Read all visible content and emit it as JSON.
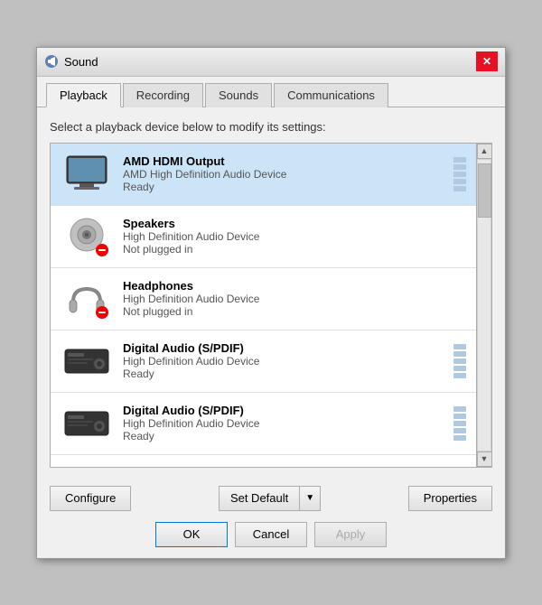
{
  "dialog": {
    "title": "Sound",
    "icon": "speaker-icon"
  },
  "tabs": [
    {
      "label": "Playback",
      "active": true
    },
    {
      "label": "Recording",
      "active": false
    },
    {
      "label": "Sounds",
      "active": false
    },
    {
      "label": "Communications",
      "active": false
    }
  ],
  "description": "Select a playback device below to modify its settings:",
  "devices": [
    {
      "name": "AMD HDMI Output",
      "driver": "AMD High Definition Audio Device",
      "status": "Ready",
      "selected": true,
      "icon": "monitor",
      "has_badge": false,
      "has_bars": true
    },
    {
      "name": "Speakers",
      "driver": "High Definition Audio Device",
      "status": "Not plugged in",
      "selected": false,
      "icon": "speaker",
      "has_badge": true,
      "has_bars": false
    },
    {
      "name": "Headphones",
      "driver": "High Definition Audio Device",
      "status": "Not plugged in",
      "selected": false,
      "icon": "headphones",
      "has_badge": true,
      "has_bars": false
    },
    {
      "name": "Digital Audio (S/PDIF)",
      "driver": "High Definition Audio Device",
      "status": "Ready",
      "selected": false,
      "icon": "digital",
      "has_badge": false,
      "has_bars": true
    },
    {
      "name": "Digital Audio (S/PDIF)",
      "driver": "High Definition Audio Device",
      "status": "Ready",
      "selected": false,
      "icon": "digital",
      "has_badge": false,
      "has_bars": true
    }
  ],
  "buttons": {
    "configure": "Configure",
    "set_default": "Set Default",
    "properties": "Properties",
    "ok": "OK",
    "cancel": "Cancel",
    "apply": "Apply"
  }
}
